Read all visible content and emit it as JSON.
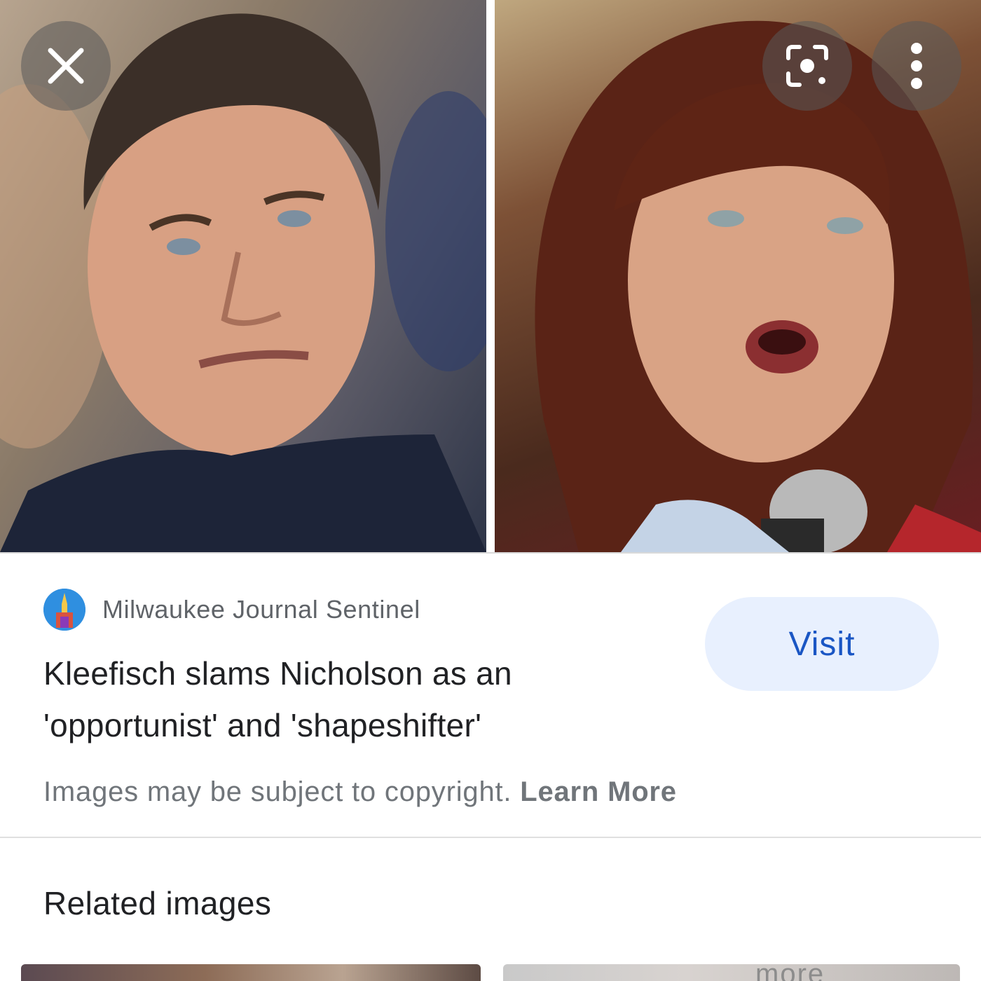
{
  "viewer": {
    "close_icon": "close-icon",
    "lens_icon": "google-lens-icon",
    "more_icon": "more-vert-icon"
  },
  "result": {
    "source_name": "Milwaukee Journal Sentinel",
    "source_icon": "site-favicon",
    "headline_line1": "Kleefisch slams Nicholson as an",
    "headline_line2": "'opportunist' and 'shapeshifter'",
    "visit_label": "Visit",
    "copyright_text": "Images may be subject to copyright.",
    "learn_more_label": "Learn More"
  },
  "related": {
    "title": "Related images",
    "thumb_2_text": "more"
  },
  "colors": {
    "visit_bg": "#e8f0fe",
    "visit_text": "#1a56c4",
    "muted_text": "#70757a",
    "body_text": "#202124"
  }
}
